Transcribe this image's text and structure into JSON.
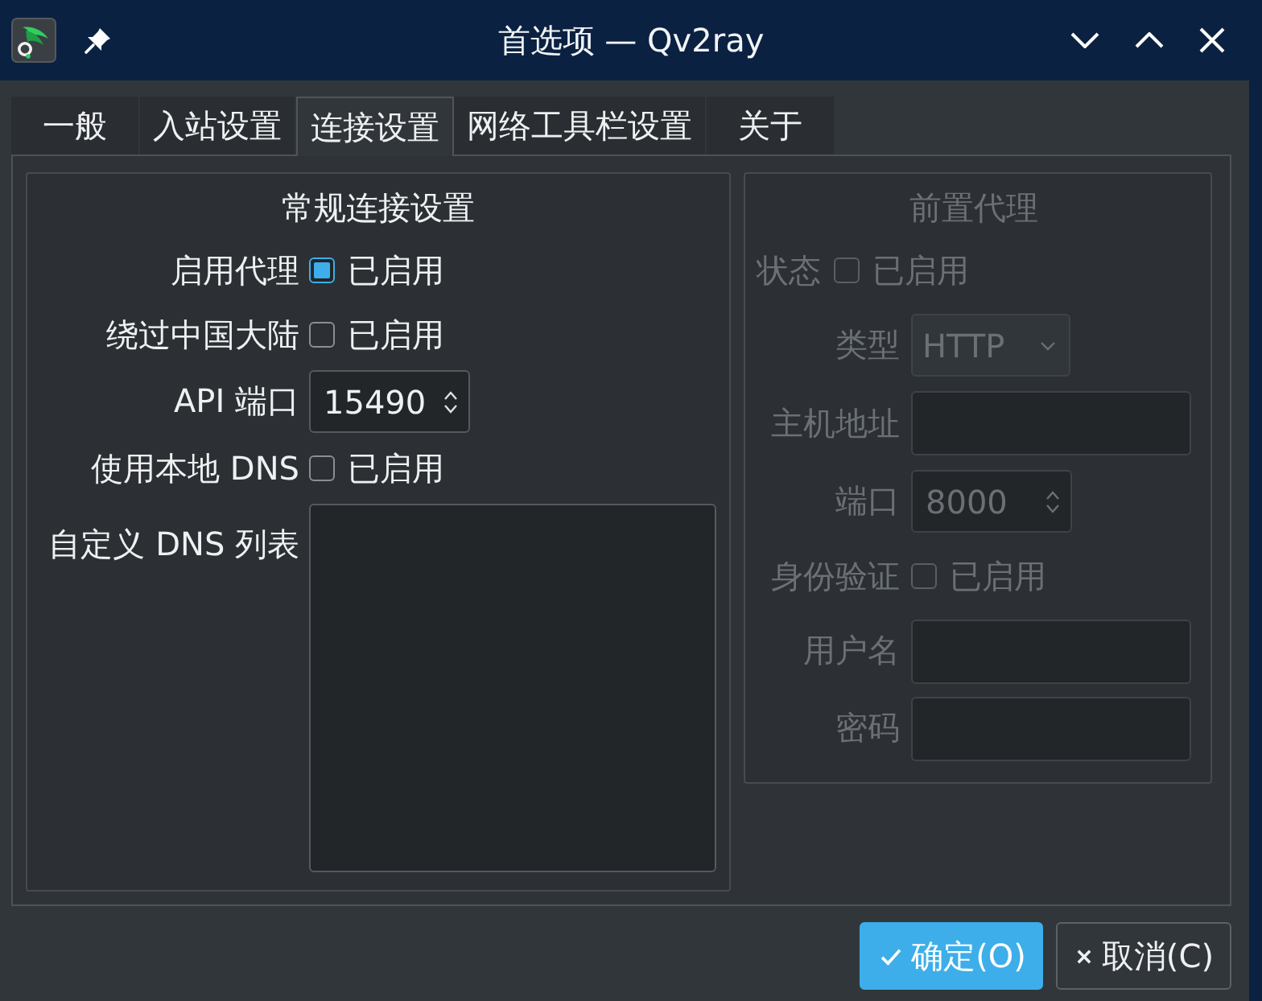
{
  "window": {
    "title": "首选项 — Qv2ray"
  },
  "tabs": [
    {
      "label": "一般",
      "selected": false
    },
    {
      "label": "入站设置",
      "selected": false
    },
    {
      "label": "连接设置",
      "selected": true
    },
    {
      "label": "网络工具栏设置",
      "selected": false
    },
    {
      "label": "关于",
      "selected": false
    }
  ],
  "general": {
    "title": "常规连接设置",
    "disabled": false,
    "rows": [
      {
        "kind": "checkbox",
        "label": "启用代理",
        "text": "已启用",
        "checked": true
      },
      {
        "kind": "checkbox",
        "label": "绕过中国大陆",
        "text": "已启用",
        "checked": false
      },
      {
        "kind": "spinbox",
        "label": "API 端口",
        "value": "15490"
      },
      {
        "kind": "checkbox",
        "label": "使用本地 DNS",
        "text": "已启用",
        "checked": false
      },
      {
        "kind": "textarea",
        "label": "自定义 DNS 列表"
      }
    ]
  },
  "forward_proxy": {
    "title": "前置代理",
    "disabled": true,
    "rows": [
      {
        "kind": "inline",
        "label": "状态",
        "text": "已启用",
        "checked": false
      },
      {
        "kind": "combo",
        "label": "类型",
        "value": "HTTP"
      },
      {
        "kind": "text",
        "label": "主机地址"
      },
      {
        "kind": "spinbox",
        "label": "端口",
        "value": "8000"
      },
      {
        "kind": "checkbox",
        "label": "身份验证",
        "text": "已启用",
        "checked": false
      },
      {
        "kind": "text",
        "label": "用户名"
      },
      {
        "kind": "text",
        "label": "密码"
      }
    ]
  },
  "buttons": [
    {
      "kind": "ok",
      "label": "确定(O)",
      "default": true
    },
    {
      "kind": "cancel",
      "label": "取消(C)",
      "default": false
    }
  ]
}
